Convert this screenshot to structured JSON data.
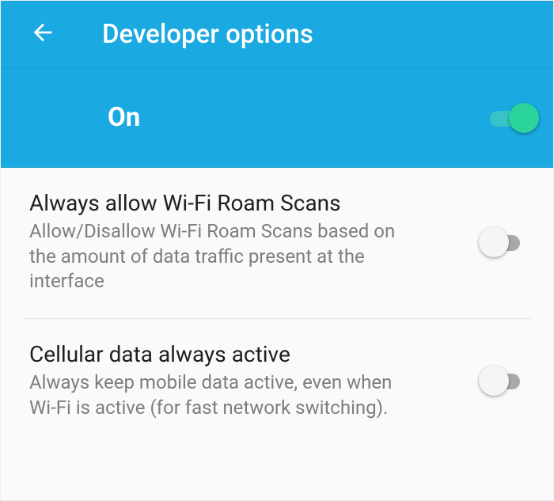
{
  "colors": {
    "primary": "#1aa9e0",
    "toggle_on_thumb": "#2ad49a",
    "toggle_on_track": "#38c3c8",
    "toggle_off_thumb": "#f5f5f5",
    "toggle_off_track": "#a9a9a9"
  },
  "header": {
    "title": "Developer options",
    "back_icon": "arrow-back-icon"
  },
  "master_toggle": {
    "label": "On",
    "state": true
  },
  "settings": [
    {
      "key": "wifi_roam_scans",
      "title": "Always allow Wi-Fi Roam Scans",
      "desc": "Allow/Disallow Wi-Fi Roam Scans based on the amount of data traffic present at the interface",
      "state": false
    },
    {
      "key": "cellular_always_active",
      "title": "Cellular data always active",
      "desc": "Always keep mobile data active, even when Wi-Fi is active (for fast network switching).",
      "state": false
    }
  ]
}
